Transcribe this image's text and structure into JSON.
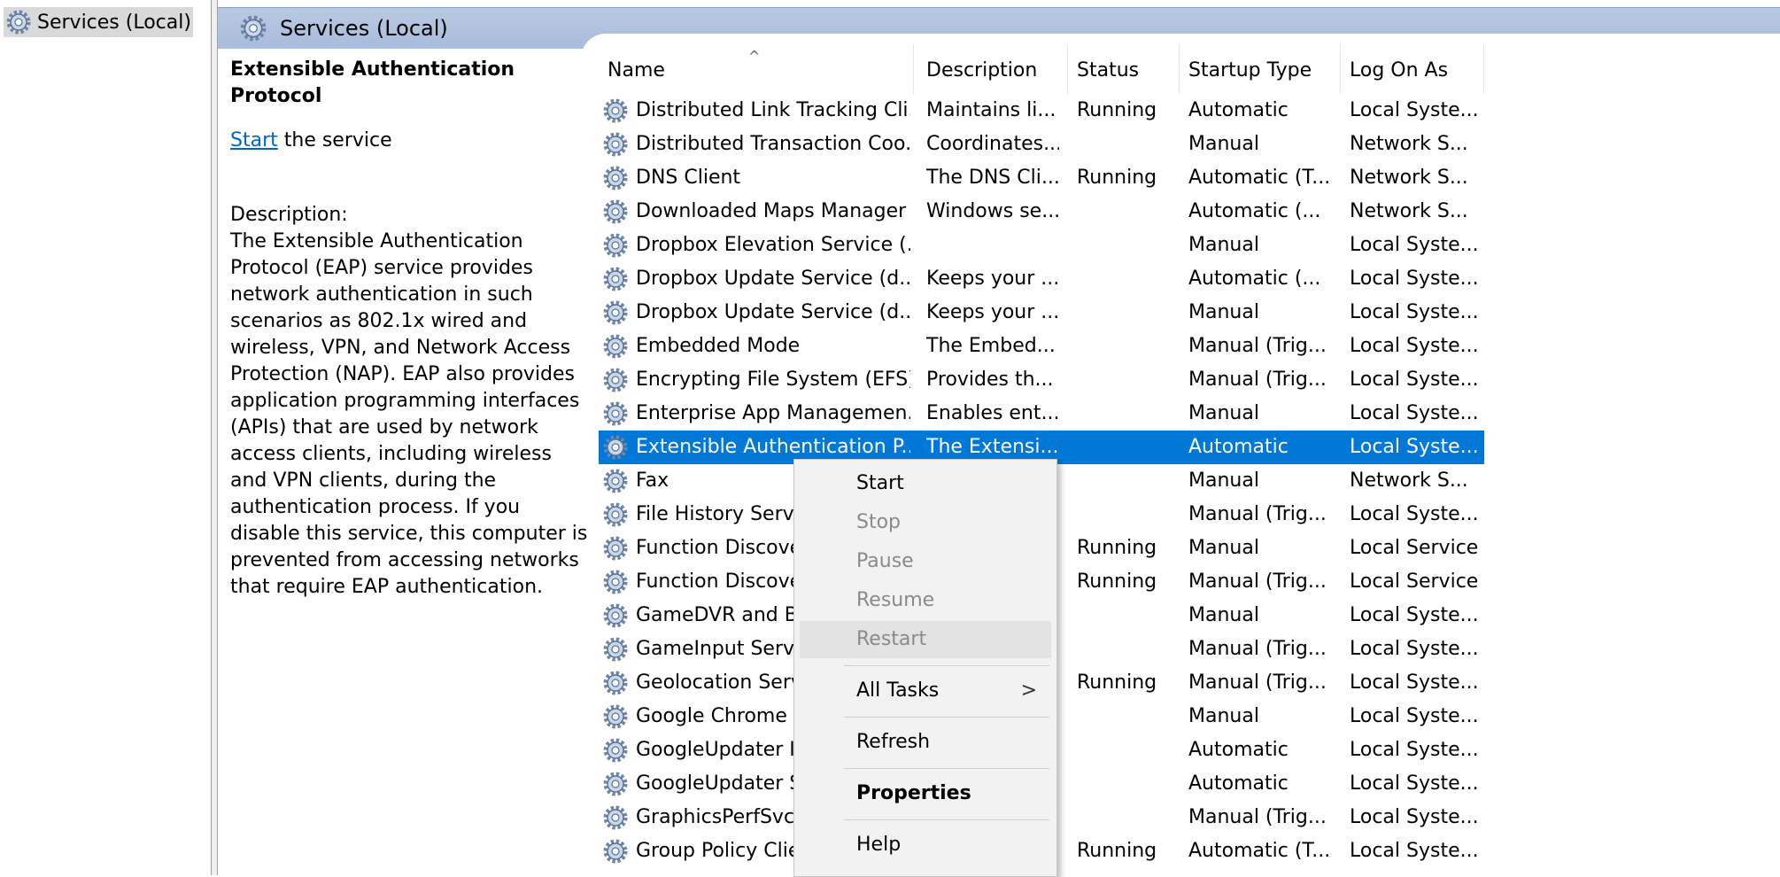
{
  "tree": {
    "root_label": "Services (Local)"
  },
  "header": {
    "title": "Services (Local)"
  },
  "detail": {
    "service_title": "Extensible Authentication Protocol",
    "start_link": "Start",
    "start_suffix": " the service",
    "description_label": "Description:",
    "description": "The Extensible Authentication Protocol (EAP) service provides network authentication in such scenarios as 802.1x wired and wireless, VPN, and Network Access Protection (NAP).  EAP also provides application programming interfaces (APIs) that are used by network access clients, including wireless and VPN clients, during the authentication process.  If you disable this service, this computer is prevented from accessing networks that require EAP authentication."
  },
  "columns": {
    "name": "Name",
    "description": "Description",
    "status": "Status",
    "startup": "Startup Type",
    "logon": "Log On As",
    "sort_arrow": "^"
  },
  "services": [
    {
      "name": "Distributed Link Tracking Cli...",
      "description": "Maintains li...",
      "status": "Running",
      "startup": "Automatic",
      "logon": "Local Syste..."
    },
    {
      "name": "Distributed Transaction Coo...",
      "description": "Coordinates...",
      "status": "",
      "startup": "Manual",
      "logon": "Network S..."
    },
    {
      "name": "DNS Client",
      "description": "The DNS Cli...",
      "status": "Running",
      "startup": "Automatic (T...",
      "logon": "Network S..."
    },
    {
      "name": "Downloaded Maps Manager",
      "description": "Windows se...",
      "status": "",
      "startup": "Automatic (...",
      "logon": "Network S..."
    },
    {
      "name": "Dropbox Elevation Service (...",
      "description": "",
      "status": "",
      "startup": "Manual",
      "logon": "Local Syste..."
    },
    {
      "name": "Dropbox Update Service (d...",
      "description": "Keeps your ...",
      "status": "",
      "startup": "Automatic (...",
      "logon": "Local Syste..."
    },
    {
      "name": "Dropbox Update Service (d...",
      "description": "Keeps your ...",
      "status": "",
      "startup": "Manual",
      "logon": "Local Syste..."
    },
    {
      "name": "Embedded Mode",
      "description": "The Embed...",
      "status": "",
      "startup": "Manual (Trig...",
      "logon": "Local Syste..."
    },
    {
      "name": "Encrypting File System (EFS)",
      "description": "Provides th...",
      "status": "",
      "startup": "Manual (Trig...",
      "logon": "Local Syste..."
    },
    {
      "name": "Enterprise App Managemen...",
      "description": "Enables ent...",
      "status": "",
      "startup": "Manual",
      "logon": "Local Syste..."
    },
    {
      "name": "Extensible Authentication P...",
      "description": "The Extensi...",
      "status": "",
      "startup": "Automatic",
      "logon": "Local Syste...",
      "selected": true
    },
    {
      "name": "Fax",
      "description": "",
      "status": "",
      "startup": "Manual",
      "logon": "Network S..."
    },
    {
      "name": "File History Servic",
      "description": "",
      "status": "",
      "startup": "Manual (Trig...",
      "logon": "Local Syste..."
    },
    {
      "name": "Function Discove",
      "description": "",
      "status": "Running",
      "startup": "Manual",
      "logon": "Local Service"
    },
    {
      "name": "Function Discove",
      "description": "",
      "status": "Running",
      "startup": "Manual (Trig...",
      "logon": "Local Service"
    },
    {
      "name": "GameDVR and Br",
      "description": "",
      "status": "",
      "startup": "Manual",
      "logon": "Local Syste..."
    },
    {
      "name": "GameInput Servic",
      "description": "",
      "status": "",
      "startup": "Manual (Trig...",
      "logon": "Local Syste..."
    },
    {
      "name": "Geolocation Serv",
      "description": "",
      "status": "Running",
      "startup": "Manual (Trig...",
      "logon": "Local Syste..."
    },
    {
      "name": "Google Chrome I",
      "description": "",
      "status": "",
      "startup": "Manual",
      "logon": "Local Syste..."
    },
    {
      "name": "GoogleUpdater In",
      "description": "",
      "status": "",
      "startup": "Automatic",
      "logon": "Local Syste..."
    },
    {
      "name": "GoogleUpdater S",
      "description": "",
      "status": "",
      "startup": "Automatic",
      "logon": "Local Syste..."
    },
    {
      "name": "GraphicsPerfSvc",
      "description": "",
      "status": "",
      "startup": "Manual (Trig...",
      "logon": "Local Syste..."
    },
    {
      "name": "Group Policy Clie",
      "description": "",
      "status": "Running",
      "startup": "Automatic (T...",
      "logon": "Local Syste..."
    }
  ],
  "context_menu": {
    "start": "Start",
    "stop": "Stop",
    "pause": "Pause",
    "resume": "Resume",
    "restart": "Restart",
    "all_tasks": "All Tasks",
    "all_tasks_arrow": ">",
    "refresh": "Refresh",
    "properties": "Properties",
    "help": "Help"
  },
  "colors": {
    "selection": "#0078d7",
    "header_bar": "#b8c9e2",
    "link": "#0066cc"
  },
  "icons": {
    "service": "gear-icon"
  }
}
